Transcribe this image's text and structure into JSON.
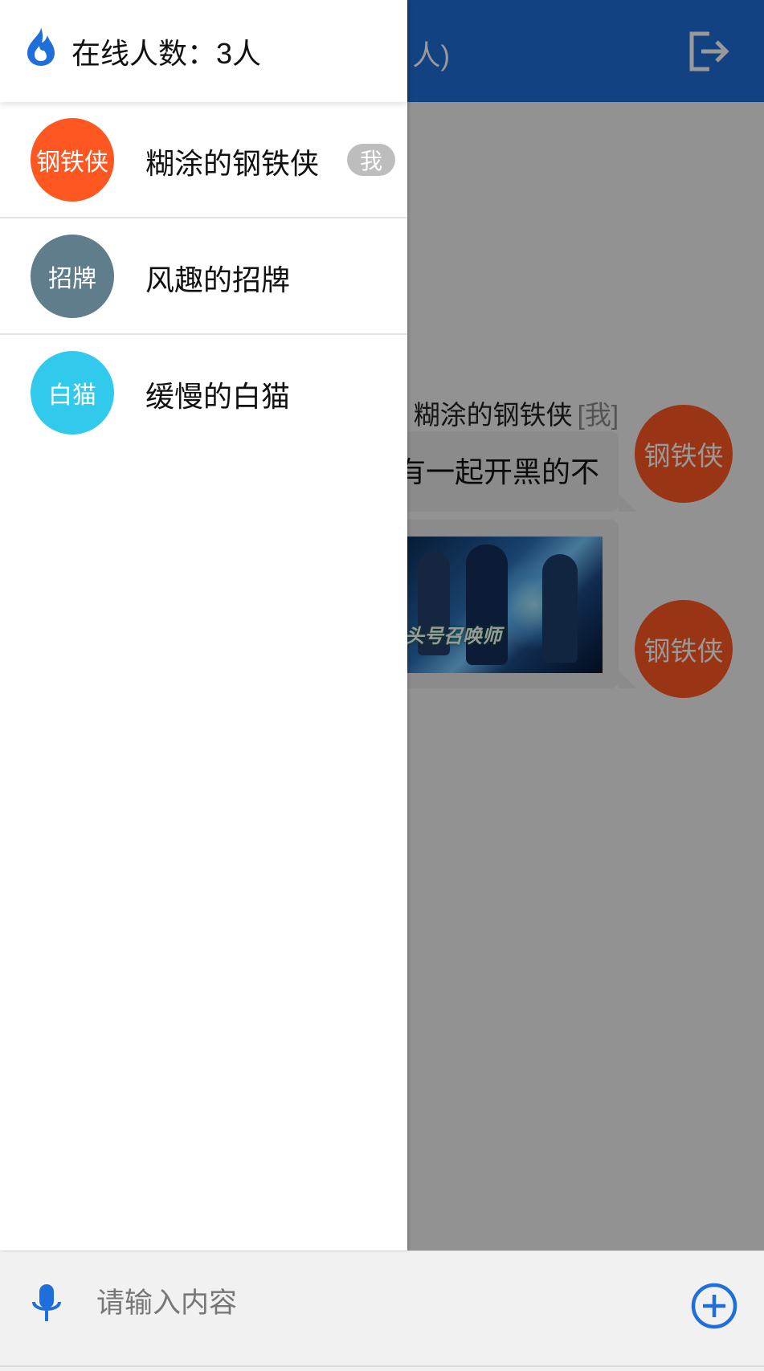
{
  "header": {
    "title_fragment": "人)",
    "logout_icon": "logout-icon"
  },
  "chat": {
    "sender_name": "糊涂的钢铁侠",
    "sender_me_tag": "[我]",
    "messages": [
      {
        "type": "text",
        "text": "有一起开黑的不",
        "avatar_label": "钢铁侠"
      },
      {
        "type": "image",
        "image_caption": "头号召唤师",
        "avatar_label": "钢铁侠"
      }
    ]
  },
  "drawer": {
    "online_label": "在线人数：3人",
    "icon": "fire-icon",
    "users": [
      {
        "avatar_label": "钢铁侠",
        "name": "糊涂的钢铁侠",
        "badge": "我",
        "avatar_color": "#ff5722"
      },
      {
        "avatar_label": "招牌",
        "name": "风趣的招牌",
        "badge": "",
        "avatar_color": "#607d8b"
      },
      {
        "avatar_label": "白猫",
        "name": "缓慢的白猫",
        "badge": "",
        "avatar_color": "#31c9ec"
      }
    ]
  },
  "input": {
    "placeholder": "请输入内容",
    "value": "",
    "mic_icon": "microphone-icon",
    "add_icon": "add-circle-icon"
  },
  "colors": {
    "primary": "#1e6fd9",
    "sender_avatar": "#ff5722"
  }
}
